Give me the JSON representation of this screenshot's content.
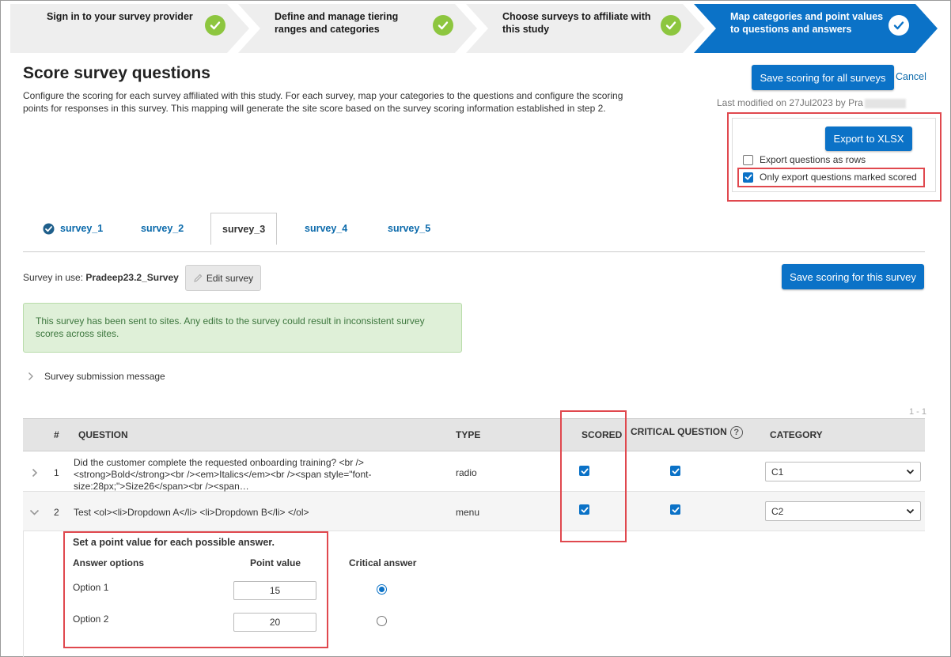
{
  "stepper": {
    "steps": [
      {
        "label": "Sign in to your survey provider"
      },
      {
        "label": "Define and manage tiering ranges and categories"
      },
      {
        "label": "Choose surveys to affiliate with this study"
      },
      {
        "label": "Map categories and point values to questions and answers"
      }
    ]
  },
  "page": {
    "title": "Score survey questions",
    "description": "Configure the scoring for each survey affiliated with this study. For each survey, map your categories to the questions and configure the scoring points for responses in this survey. This mapping will generate the site score based on the survey scoring information established in step 2.",
    "save_all_label": "Save scoring for all surveys",
    "cancel_label": "Cancel",
    "last_modified": "Last modified on 27Jul2023 by Pra"
  },
  "export": {
    "button_label": "Export to XLSX",
    "rows_label": "Export questions as rows",
    "scored_only_label": "Only export questions marked scored"
  },
  "tabs": [
    {
      "label": "survey_1"
    },
    {
      "label": "survey_2"
    },
    {
      "label": "survey_3"
    },
    {
      "label": "survey_4"
    },
    {
      "label": "survey_5"
    }
  ],
  "survey": {
    "in_use_label": "Survey in use:",
    "in_use_value": "Pradeep23.2_Survey",
    "edit_label": "Edit survey",
    "save_label": "Save scoring for this survey",
    "alert": "This survey has been sent to sites. Any edits to the survey could result in inconsistent survey scores across sites.",
    "submission_message_label": "Survey submission message"
  },
  "table": {
    "pager": "1 - 1",
    "headers": {
      "num": "#",
      "question": "QUESTION",
      "type": "TYPE",
      "scored": "SCORED",
      "critical": "CRITICAL QUESTION",
      "category": "CATEGORY"
    },
    "rows": [
      {
        "num": "1",
        "question": "Did the customer complete the requested onboarding training? <br /> <strong>Bold</strong><br /><em>Italics</em><br /><span style=\"font-size:28px;\">Size26</span><br /><span…",
        "type": "radio",
        "category": "C1"
      },
      {
        "num": "2",
        "question": "Test <ol><li>Dropdown A</li> <li>Dropdown B</li> </ol>",
        "type": "menu",
        "category": "C2"
      }
    ]
  },
  "answers": {
    "heading": "Set a point value for each possible answer.",
    "col_options": "Answer options",
    "col_points": "Point value",
    "col_critical": "Critical answer",
    "options": [
      {
        "label": "Option 1",
        "points": "15"
      },
      {
        "label": "Option 2",
        "points": "20"
      }
    ]
  }
}
